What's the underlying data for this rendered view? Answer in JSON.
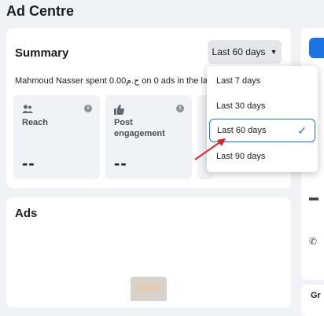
{
  "page": {
    "title": "Ad Centre"
  },
  "summary": {
    "title": "Summary",
    "period_button": "Last 60 days",
    "spent_text": "Mahmoud Nasser spent 0.00ج.م on 0 ads in the last",
    "metrics": [
      {
        "icon": "people-icon",
        "label": "Reach",
        "value": "--"
      },
      {
        "icon": "thumbs-up-icon",
        "label": "Post engagement",
        "value": "--"
      }
    ]
  },
  "dropdown": {
    "options": [
      "Last 7 days",
      "Last 30 days",
      "Last 60 days",
      "Last 90 days"
    ],
    "selected": "Last 60 days"
  },
  "ads": {
    "title": "Ads"
  },
  "right_panel": {
    "partial_text": "Gr"
  },
  "colors": {
    "accent": "#1b74e4",
    "annotation_arrow": "#e0202a",
    "background": "#f0f2f5"
  }
}
